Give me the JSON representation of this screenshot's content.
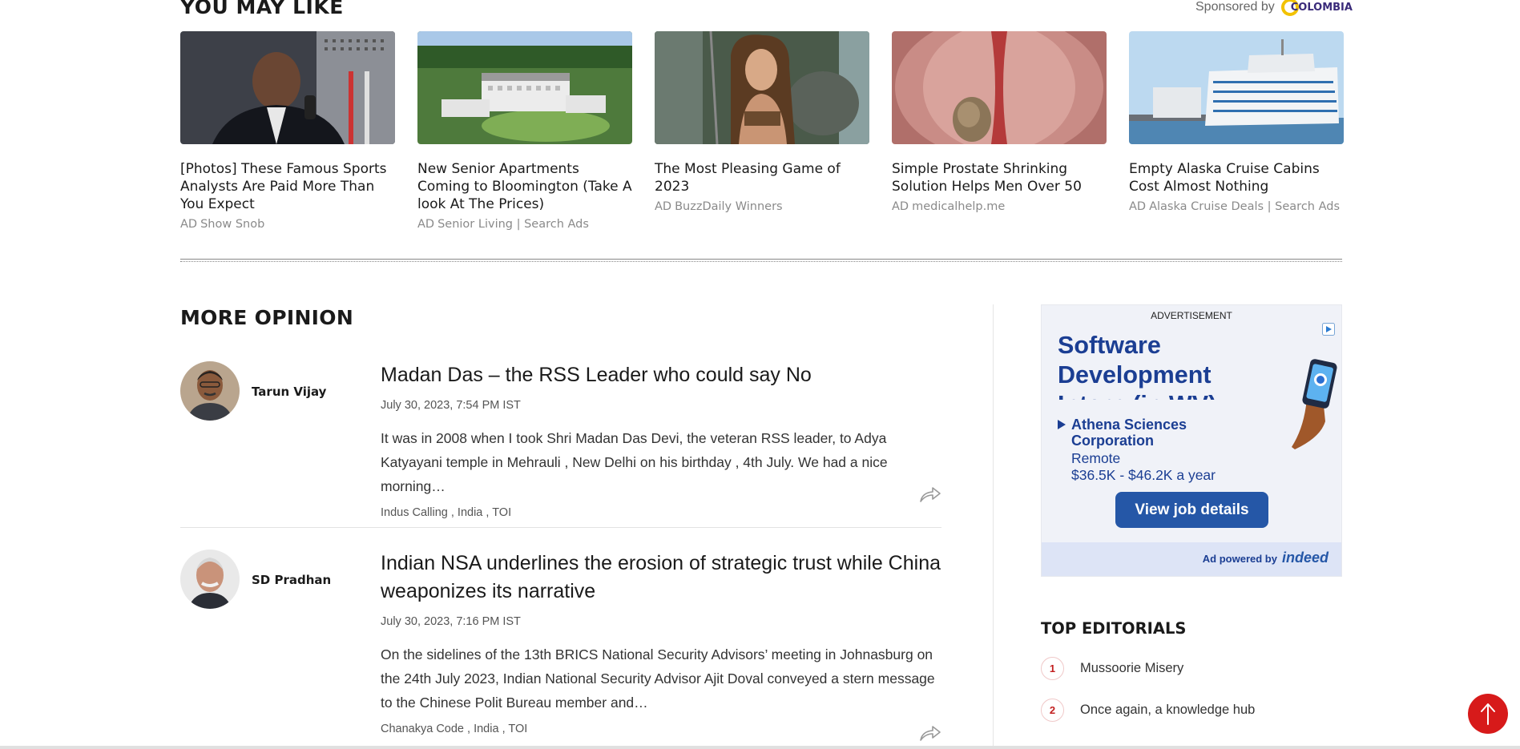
{
  "you_may_like": {
    "title": "YOU MAY LIKE",
    "sponsored_by": "Sponsored by",
    "sponsor_logo": "COLOMBIA",
    "cards": [
      {
        "title": "[Photos] These Famous Sports Analysts Are Paid More Than You Expect",
        "ad": "AD",
        "source": "Show Snob",
        "image": "man-speaking-at-mic"
      },
      {
        "title": "New Senior Apartments Coming to Bloomington (Take A look At The Prices)",
        "ad": "AD",
        "source": "Senior Living | Search Ads",
        "image": "aerial-apartment-complex"
      },
      {
        "title": "The Most Pleasing Game of 2023",
        "ad": "AD",
        "source": "BuzzDaily Winners",
        "image": "fantasy-game-character"
      },
      {
        "title": "Simple Prostate Shrinking Solution Helps Men Over 50",
        "ad": "AD",
        "source": "medicalhelp.me",
        "image": "medical-illustration"
      },
      {
        "title": "Empty Alaska Cruise Cabins Cost Almost Nothing",
        "ad": "AD",
        "source": "Alaska Cruise Deals | Search Ads",
        "image": "cruise-ship"
      }
    ]
  },
  "more_opinion": {
    "title": "MORE OPINION",
    "articles": [
      {
        "author": "Tarun Vijay",
        "headline": "Madan Das – the RSS Leader who could say No",
        "date": "July 30, 2023, 7:54 PM IST",
        "excerpt": "It was in 2008 when I took Shri Madan Das Devi, the veteran RSS leader, to Adya Katyayani temple in Mehrauli , New Delhi on his birthday , 4th July. We had a nice morning…",
        "tags": [
          "Indus Calling",
          "India",
          "TOI"
        ]
      },
      {
        "author": "SD Pradhan",
        "headline": "Indian NSA underlines the erosion of strategic trust while China weaponizes its narrative",
        "date": "July 30, 2023, 7:16 PM IST",
        "excerpt": "On the sidelines of the 13th BRICS National Security Advisors’ meeting in Johnasburg on the 24th July 2023, Indian National Security Advisor Ajit Doval conveyed a stern message to the Chinese Polit Bureau member and…",
        "tags": [
          "Chanakya Code",
          "India",
          "TOI"
        ]
      }
    ]
  },
  "advertisement": {
    "label": "ADVERTISEMENT",
    "headline": "Software Development Intern (in WV)",
    "company": "Athena Sciences Corporation",
    "location": "Remote",
    "pay": "$36.5K - $46.2K a year",
    "button": "View job details",
    "powered_by": "Ad powered by",
    "brand": "indeed"
  },
  "top_editorials": {
    "title": "TOP EDITORIALS",
    "items": [
      {
        "num": "1",
        "text": "Mussoorie Misery"
      },
      {
        "num": "2",
        "text": "Once again, a knowledge hub"
      }
    ]
  },
  "colors": {
    "accent_red": "#d71a1a",
    "indeed_blue": "#2557a7",
    "ad_navy": "#1b3e93"
  }
}
